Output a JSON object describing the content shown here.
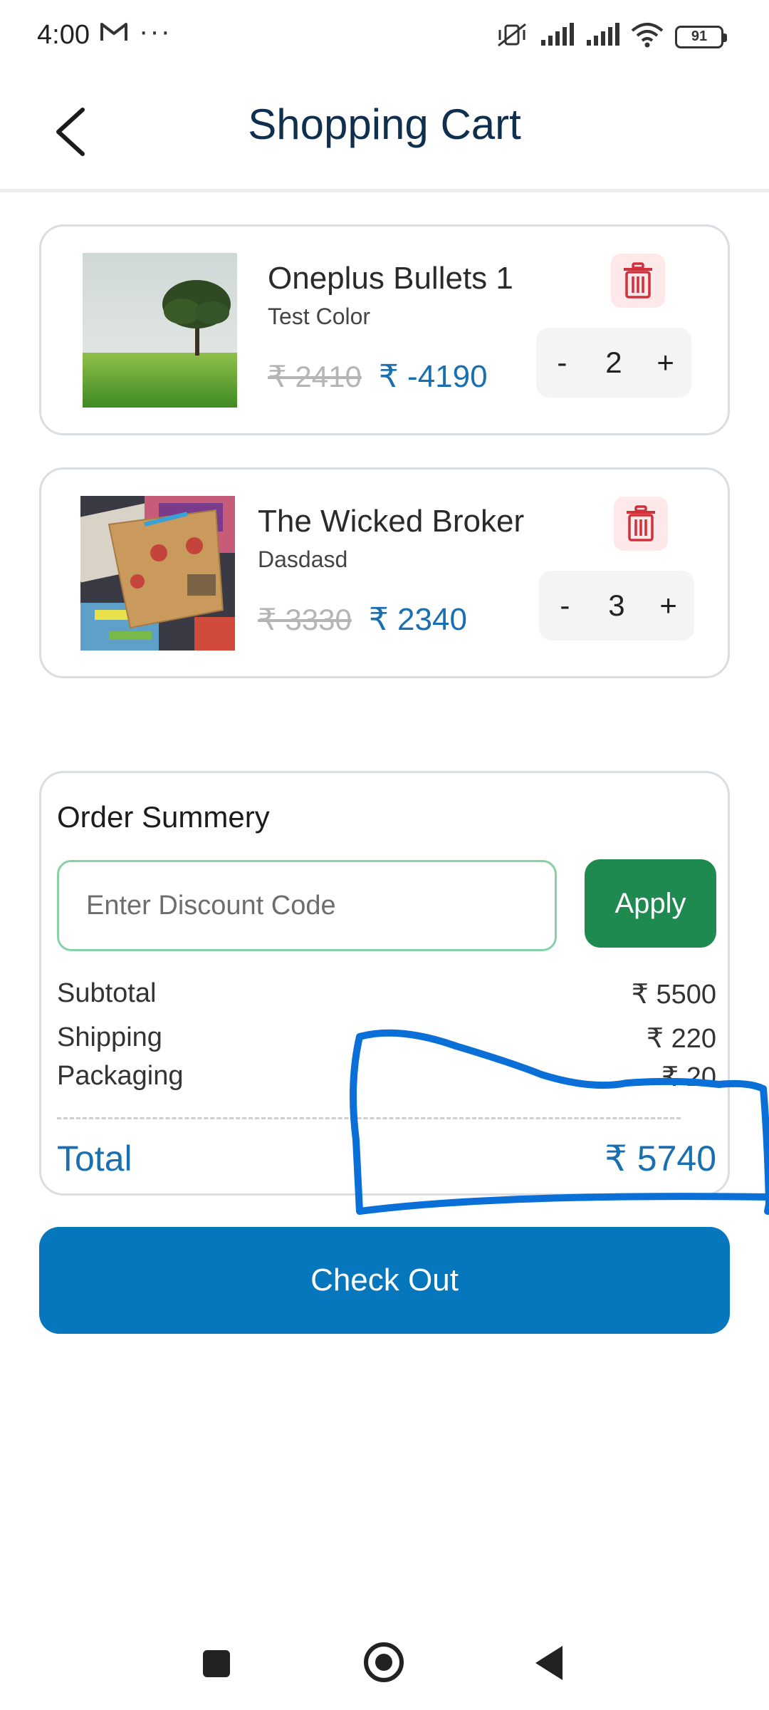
{
  "status_bar": {
    "time": "4:00",
    "battery": "91",
    "icons": [
      "gmail-icon",
      "more-icon",
      "mute-vibrate-icon",
      "signal-icon",
      "signal-icon",
      "wifi-icon",
      "battery-icon"
    ]
  },
  "header": {
    "title": "Shopping Cart",
    "back_icon": "back-arrow-icon"
  },
  "cart": {
    "items": [
      {
        "name": "Oneplus Bullets 1",
        "variant": "Test Color",
        "original_price": "₹ 2410",
        "price": "₹ -4190",
        "quantity": "2",
        "decrement_label": "-",
        "increment_label": "+",
        "delete_icon": "trash-icon"
      },
      {
        "name": "The Wicked Broker",
        "variant": "Dasdasd",
        "original_price": "₹ 3330",
        "price": "₹ 2340",
        "quantity": "3",
        "decrement_label": "-",
        "increment_label": "+",
        "delete_icon": "trash-icon"
      }
    ]
  },
  "summary": {
    "title": "Order Summery",
    "discount_placeholder": "Enter Discount Code",
    "apply_label": "Apply",
    "subtotal_label": "Subtotal",
    "subtotal_value": "₹ 5500",
    "shipping_label": "Shipping",
    "shipping_value": "₹ 220",
    "packaging_label": "Packaging",
    "packaging_value": "₹ 20",
    "total_label": "Total",
    "total_value": "₹ 5740"
  },
  "checkout_label": "Check Out",
  "nav": {
    "icons": [
      "recents-icon",
      "home-icon",
      "back-icon"
    ]
  },
  "colors": {
    "accent": "#1a6fb0",
    "checkout": "#0676bd",
    "apply": "#1f8a4f",
    "title": "#0f2f4f",
    "delete_bg": "#fde9ea",
    "delete_icon": "#d0313b",
    "annotation": "#0a6fd6"
  }
}
